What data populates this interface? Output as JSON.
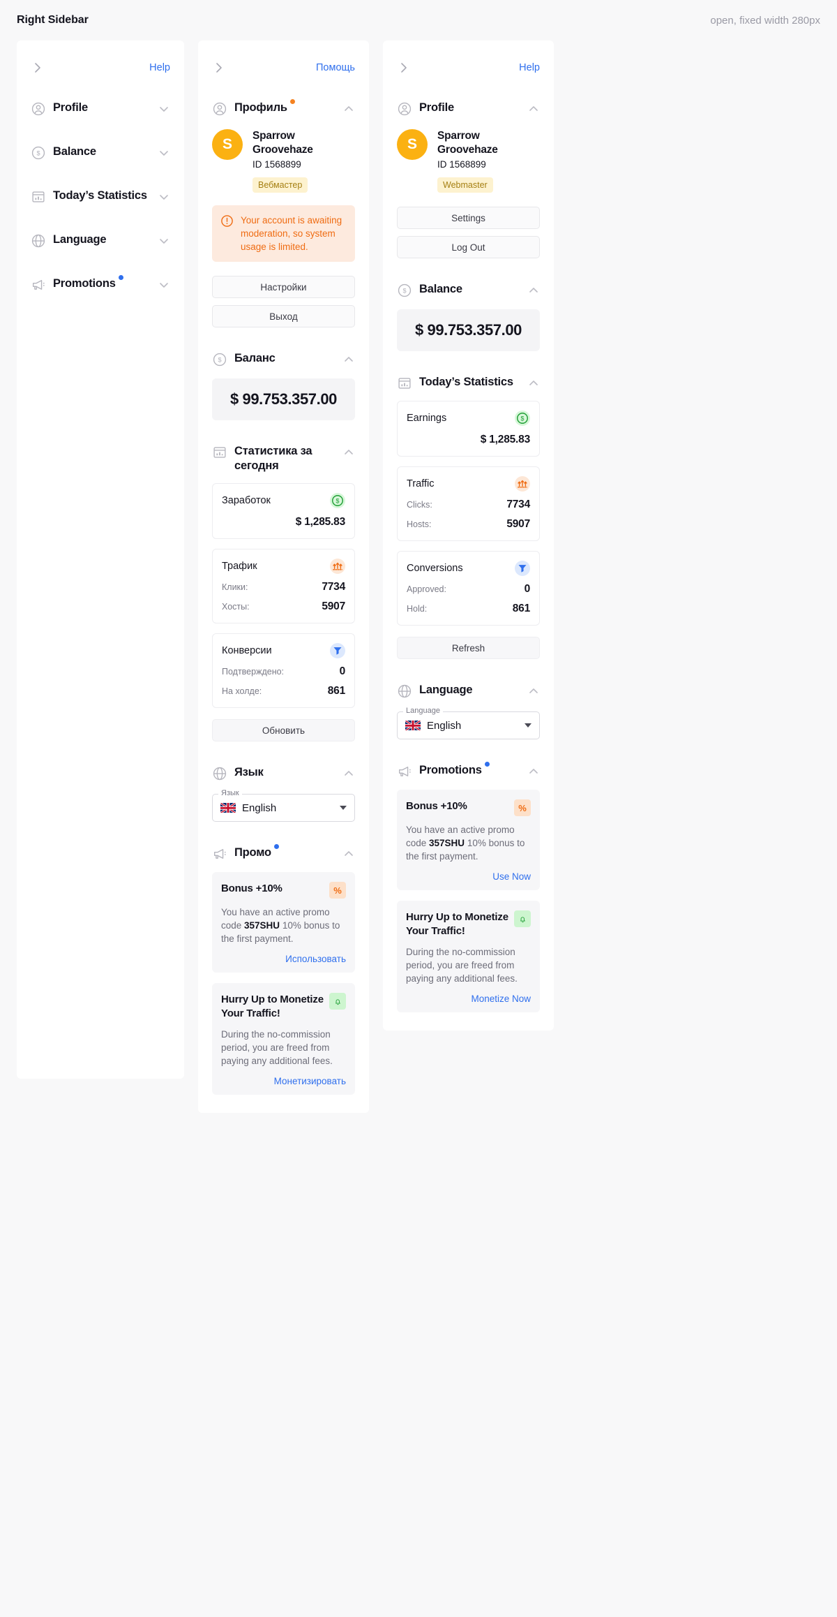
{
  "topbar": {
    "title": "Right Sidebar",
    "note": "open, fixed width 280px"
  },
  "icons": {
    "chevron_right": "chevron-right-icon",
    "profile": "user-circle-icon",
    "balance": "dollar-circle-icon",
    "statistics": "bar-chart-icon",
    "language": "globe-icon",
    "promotions": "megaphone-icon"
  },
  "colors": {
    "accent_blue": "#2f6fed",
    "avatar_orange": "#fbb112",
    "alert_orange": "#ef6c13",
    "alert_bg": "#fdeade",
    "role_badge_bg": "#fdf2cf",
    "role_badge_text": "#a57f12",
    "earnings_green": "#1e9e34",
    "traffic_orange": "#ef6c13",
    "conversions_blue": "#2f6fed",
    "dot_blue": "#2f6fed",
    "dot_orange": "#f58220"
  },
  "collapsed": {
    "help_label": "Help",
    "items": [
      {
        "label": "Profile",
        "icon": "user-circle-icon",
        "badge": null
      },
      {
        "label": "Balance",
        "icon": "dollar-circle-icon",
        "badge": null
      },
      {
        "label": "Today’s Statistics",
        "icon": "bar-chart-icon",
        "badge": null
      },
      {
        "label": "Language",
        "icon": "globe-icon",
        "badge": null
      },
      {
        "label": "Promotions",
        "icon": "megaphone-icon",
        "badge": "blue"
      }
    ]
  },
  "ru": {
    "help_label": "Помощь",
    "profile": {
      "section_title": "Профиль",
      "badge_dot": "orange",
      "avatar_initial": "S",
      "name": "Sparrow Groovehaze",
      "id": "ID 1568899",
      "role": "Вебмастер",
      "alert": "Your account is awaiting moderation, so system usage is limited.",
      "settings_label": "Настройки",
      "logout_label": "Выход"
    },
    "balance": {
      "section_title": "Баланс",
      "amount": "$ 99.753.357.00"
    },
    "statistics": {
      "section_title": "Статистика за сегодня",
      "earnings": {
        "label": "Заработок",
        "value": "$ 1,285.83"
      },
      "traffic": {
        "label": "Трафик",
        "rows": [
          {
            "label": "Клики:",
            "value": "7734"
          },
          {
            "label": "Хосты:",
            "value": "5907"
          }
        ]
      },
      "conversions": {
        "label": "Конверсии",
        "rows": [
          {
            "label": "Подтверждено:",
            "value": "0"
          },
          {
            "label": "На холде:",
            "value": "861"
          }
        ]
      },
      "refresh_label": "Обновить"
    },
    "language": {
      "section_title": "Язык",
      "field_legend": "Язык",
      "selected": "English"
    },
    "promotions": {
      "section_title": "Промо",
      "badge_dot": "blue",
      "cards": [
        {
          "title": "Bonus +10%",
          "badge": "%",
          "badge_style": "orange",
          "body_pre": "You have an active promo code ",
          "body_bold": "357SHU",
          "body_post": " 10% bonus to the first payment.",
          "link": "Использовать"
        },
        {
          "title": "Hurry Up to Monetize Your Traffic!",
          "badge": "bell-icon",
          "badge_style": "green",
          "body_pre": "During the no-commission period, you are freed from paying any additional fees.",
          "body_bold": "",
          "body_post": "",
          "link": "Монетизировать"
        }
      ]
    }
  },
  "en": {
    "help_label": "Help",
    "profile": {
      "section_title": "Profile",
      "badge_dot": null,
      "avatar_initial": "S",
      "name": "Sparrow Groovehaze",
      "id": "ID 1568899",
      "role": "Webmaster",
      "settings_label": "Settings",
      "logout_label": "Log Out"
    },
    "balance": {
      "section_title": "Balance",
      "amount": "$ 99.753.357.00"
    },
    "statistics": {
      "section_title": "Today’s Statistics",
      "earnings": {
        "label": "Earnings",
        "value": "$ 1,285.83"
      },
      "traffic": {
        "label": "Traffic",
        "rows": [
          {
            "label": "Clicks:",
            "value": "7734"
          },
          {
            "label": "Hosts:",
            "value": "5907"
          }
        ]
      },
      "conversions": {
        "label": "Conversions",
        "rows": [
          {
            "label": "Approved:",
            "value": "0"
          },
          {
            "label": "Hold:",
            "value": "861"
          }
        ]
      },
      "refresh_label": "Refresh"
    },
    "language": {
      "section_title": "Language",
      "field_legend": "Language",
      "selected": "English"
    },
    "promotions": {
      "section_title": "Promotions",
      "badge_dot": "blue",
      "cards": [
        {
          "title": "Bonus +10%",
          "badge": "%",
          "badge_style": "orange",
          "body_pre": "You have an active promo code ",
          "body_bold": "357SHU",
          "body_post": " 10% bonus to the first payment.",
          "link": "Use Now"
        },
        {
          "title": "Hurry Up to Monetize Your Traffic!",
          "badge": "bell-icon",
          "badge_style": "green",
          "body_pre": "During the no-commission period, you are freed from paying any additional fees.",
          "body_bold": "",
          "body_post": "",
          "link": "Monetize Now"
        }
      ]
    }
  }
}
